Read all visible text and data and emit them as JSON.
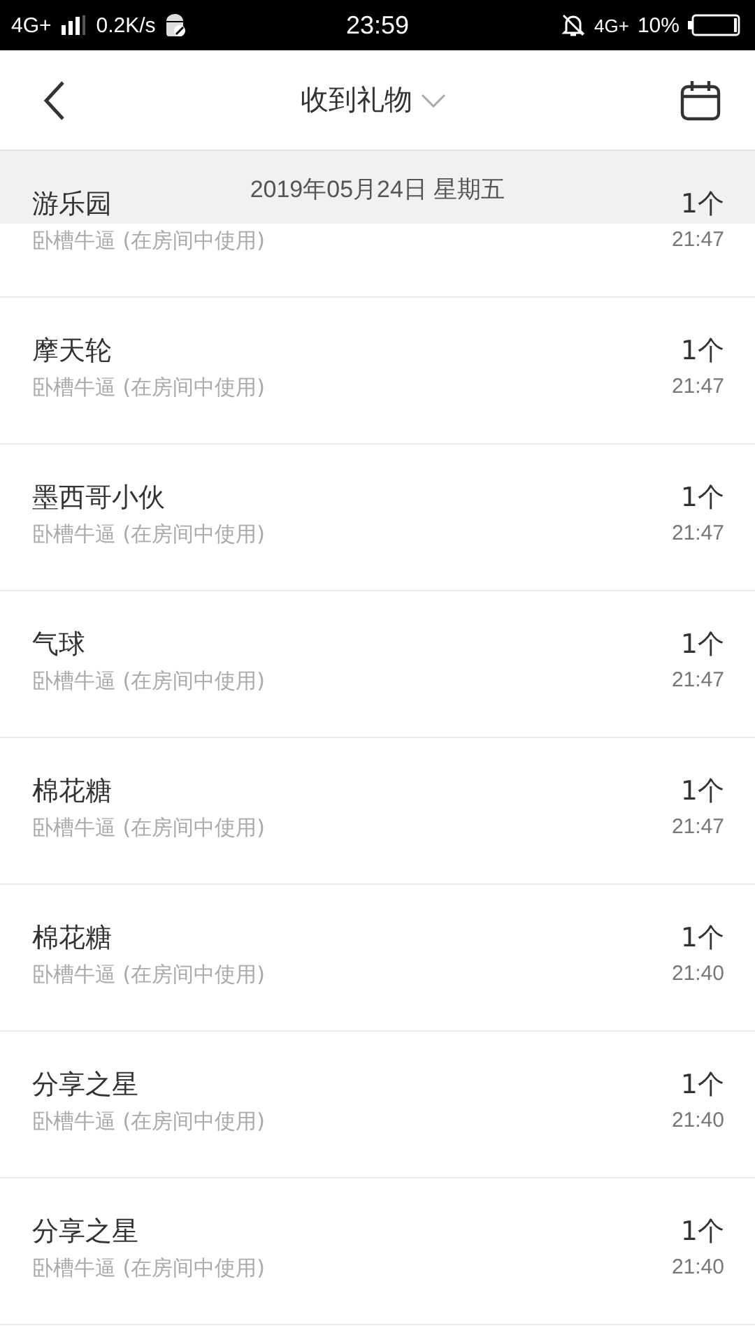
{
  "status_bar": {
    "network": "4G+",
    "speed": "0.2K/s",
    "time": "23:59",
    "network_right": "4G+",
    "battery": "10%"
  },
  "header": {
    "title": "收到礼物"
  },
  "date_header": "2019年05月24日 星期五",
  "gifts": [
    {
      "name": "游乐园",
      "note": "卧槽牛逼 (在房间中使用)",
      "count": "1个",
      "time": "21:47"
    },
    {
      "name": "摩天轮",
      "note": "卧槽牛逼 (在房间中使用)",
      "count": "1个",
      "time": "21:47"
    },
    {
      "name": "墨西哥小伙",
      "note": "卧槽牛逼 (在房间中使用)",
      "count": "1个",
      "time": "21:47"
    },
    {
      "name": "气球",
      "note": "卧槽牛逼 (在房间中使用)",
      "count": "1个",
      "time": "21:47"
    },
    {
      "name": "棉花糖",
      "note": "卧槽牛逼 (在房间中使用)",
      "count": "1个",
      "time": "21:47"
    },
    {
      "name": "棉花糖",
      "note": "卧槽牛逼 (在房间中使用)",
      "count": "1个",
      "time": "21:40"
    },
    {
      "name": "分享之星",
      "note": "卧槽牛逼 (在房间中使用)",
      "count": "1个",
      "time": "21:40"
    },
    {
      "name": "分享之星",
      "note": "卧槽牛逼 (在房间中使用)",
      "count": "1个",
      "time": "21:40"
    }
  ]
}
